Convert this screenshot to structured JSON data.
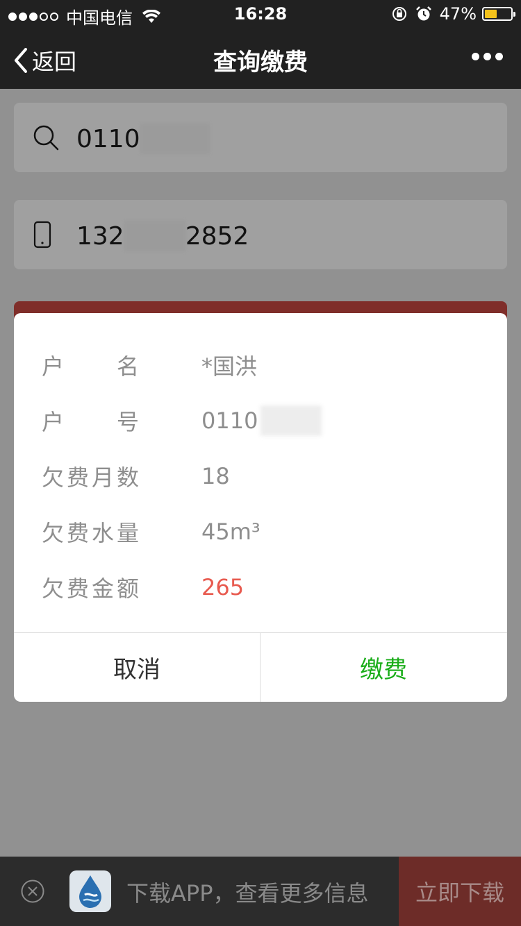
{
  "status_bar": {
    "carrier": "中国电信",
    "time": "16:28",
    "battery": "47%",
    "battery_level": 0.47,
    "battery_color": "#f4c21b"
  },
  "nav": {
    "back_label": "返回",
    "title": "查询缴费"
  },
  "search": {
    "value_prefix": "0110"
  },
  "phone": {
    "value_prefix": "132",
    "value_suffix": "2852"
  },
  "dialog": {
    "rows": [
      {
        "label": "户　　名",
        "value": "*国洪"
      },
      {
        "label": "户　　号",
        "value": "0110"
      },
      {
        "label": "欠费月数",
        "value": "18"
      },
      {
        "label": "欠费水量",
        "value": "45m³"
      },
      {
        "label": "欠费金额",
        "value": "265"
      }
    ],
    "cancel_label": "取消",
    "pay_label": "缴费",
    "pay_color": "#1aad19",
    "amount_color": "#e85a4f"
  },
  "banner": {
    "promo_text": "下载APP，查看更多信息",
    "download_label": "立即下载"
  }
}
